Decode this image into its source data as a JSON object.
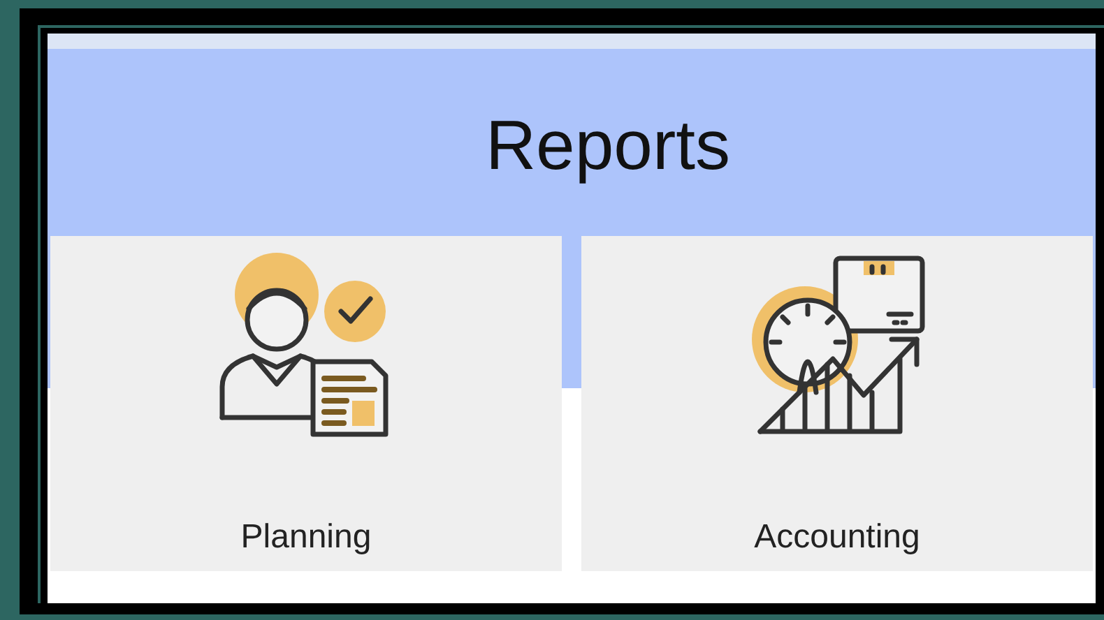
{
  "header": {
    "title": "Reports"
  },
  "cards": [
    {
      "label": "Planning",
      "kind": "planning"
    },
    {
      "label": "Accounting",
      "kind": "accounting"
    }
  ]
}
